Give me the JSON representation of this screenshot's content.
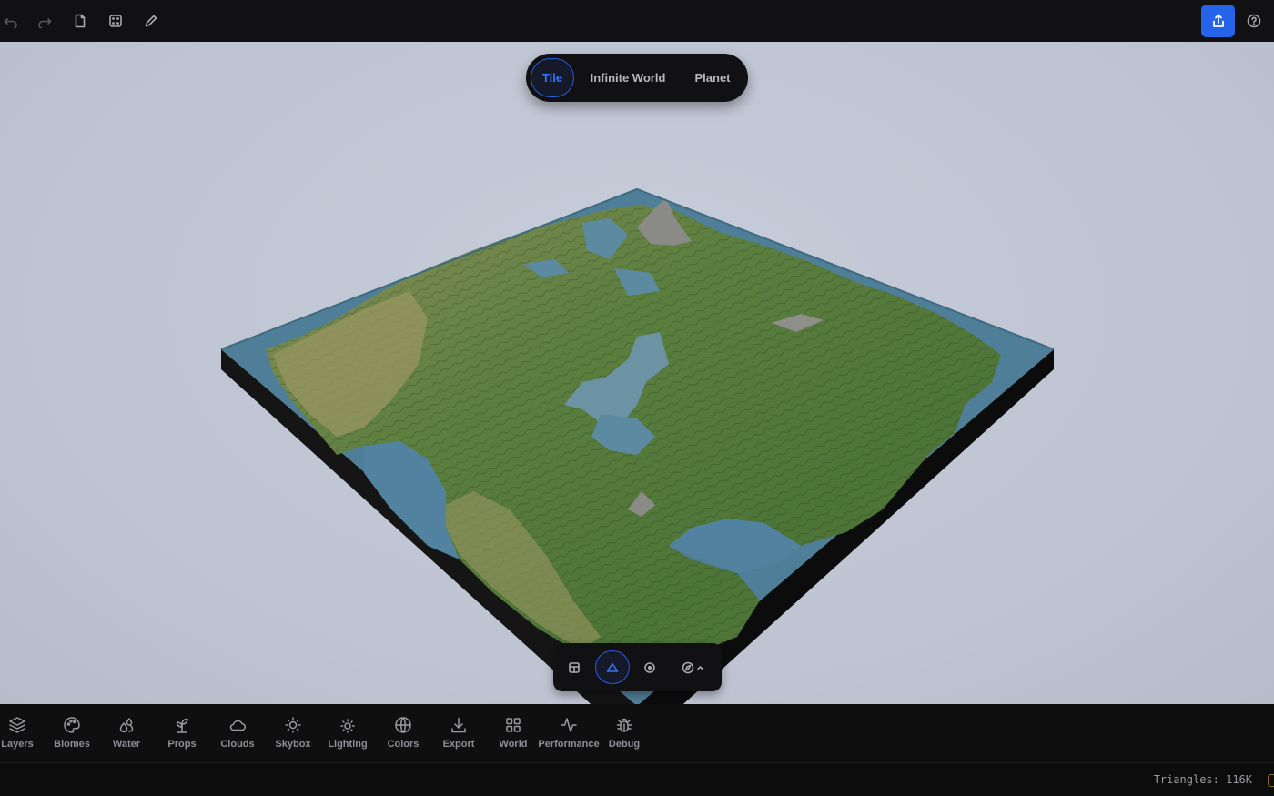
{
  "toolbar": {
    "undo_icon": "undo-icon",
    "redo_icon": "redo-icon",
    "new_file_icon": "file-icon",
    "randomize_icon": "dice-icon",
    "edit_icon": "pencil-icon",
    "share_icon": "share-icon",
    "help_icon": "help-icon",
    "accent_color": "#2563eb"
  },
  "mode_switch": {
    "options": [
      "Tile",
      "Infinite World",
      "Planet"
    ],
    "selected": "Tile"
  },
  "camera_controls": {
    "buttons": [
      "top-view-icon",
      "perspective-icon",
      "orbit-target-icon",
      "compass-icon"
    ],
    "selected": "perspective-icon"
  },
  "tools": [
    {
      "label": "Layers",
      "icon": "layers-icon"
    },
    {
      "label": "Biomes",
      "icon": "palette-icon"
    },
    {
      "label": "Water",
      "icon": "water-drops-icon"
    },
    {
      "label": "Props",
      "icon": "sprout-icon"
    },
    {
      "label": "Clouds",
      "icon": "cloud-icon"
    },
    {
      "label": "Skybox",
      "icon": "sun-icon"
    },
    {
      "label": "Lighting",
      "icon": "light-icon"
    },
    {
      "label": "Colors",
      "icon": "globe-icon"
    },
    {
      "label": "Export",
      "icon": "download-icon"
    },
    {
      "label": "World",
      "icon": "grid-icon"
    },
    {
      "label": "Performance",
      "icon": "activity-icon"
    },
    {
      "label": "Debug",
      "icon": "bug-icon"
    }
  ],
  "status": {
    "triangles": "Triangles: 116K"
  }
}
